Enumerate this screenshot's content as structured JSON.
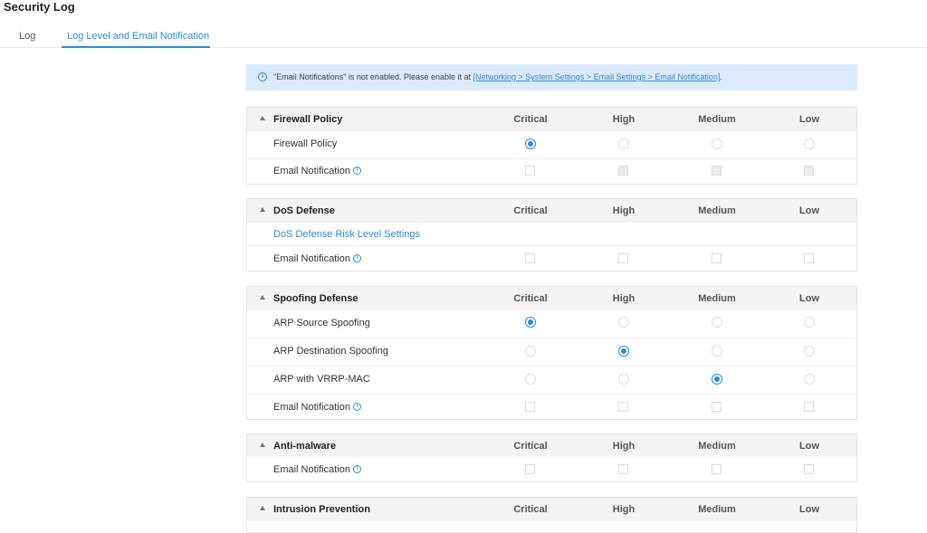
{
  "page_title": "Security Log",
  "tabs": [
    {
      "label": "Log"
    },
    {
      "label": "Log Level and Email Notification"
    }
  ],
  "notice": {
    "text": "\"Email Notifications\" is not enabled. Please enable it at ",
    "link": "[Networking > System Settings > Email Settings > Email Notification]",
    "suffix": "."
  },
  "columns": [
    "Critical",
    "High",
    "Medium",
    "Low"
  ],
  "sections": {
    "firewall": {
      "title": "Firewall Policy",
      "rows": [
        {
          "label": "Firewall Policy",
          "selected": "Critical"
        },
        {
          "label": "Email Notification"
        }
      ]
    },
    "dos": {
      "title": "DoS Defense",
      "rows": [
        {
          "label": "DoS Defense Risk Level Settings"
        },
        {
          "label": "Email Notification"
        }
      ]
    },
    "spoofing": {
      "title": "Spoofing Defense",
      "rows": [
        {
          "label": "ARP Source Spoofing",
          "selected": "Critical"
        },
        {
          "label": "ARP Destination Spoofing",
          "selected": "High"
        },
        {
          "label": "ARP with VRRP-MAC",
          "selected": "Medium"
        },
        {
          "label": "Email Notification"
        }
      ]
    },
    "antimalware": {
      "title": "Anti-malware",
      "rows": [
        {
          "label": "Email Notification"
        }
      ]
    },
    "intrusion": {
      "title": "Intrusion Prevention"
    }
  },
  "colors": {
    "accent": "#2a8be0",
    "notice_bg": "#dbeafb",
    "header_bg": "#f4f4f4"
  },
  "icons": {
    "info": "info-icon",
    "collapse": "caret-up-icon"
  }
}
